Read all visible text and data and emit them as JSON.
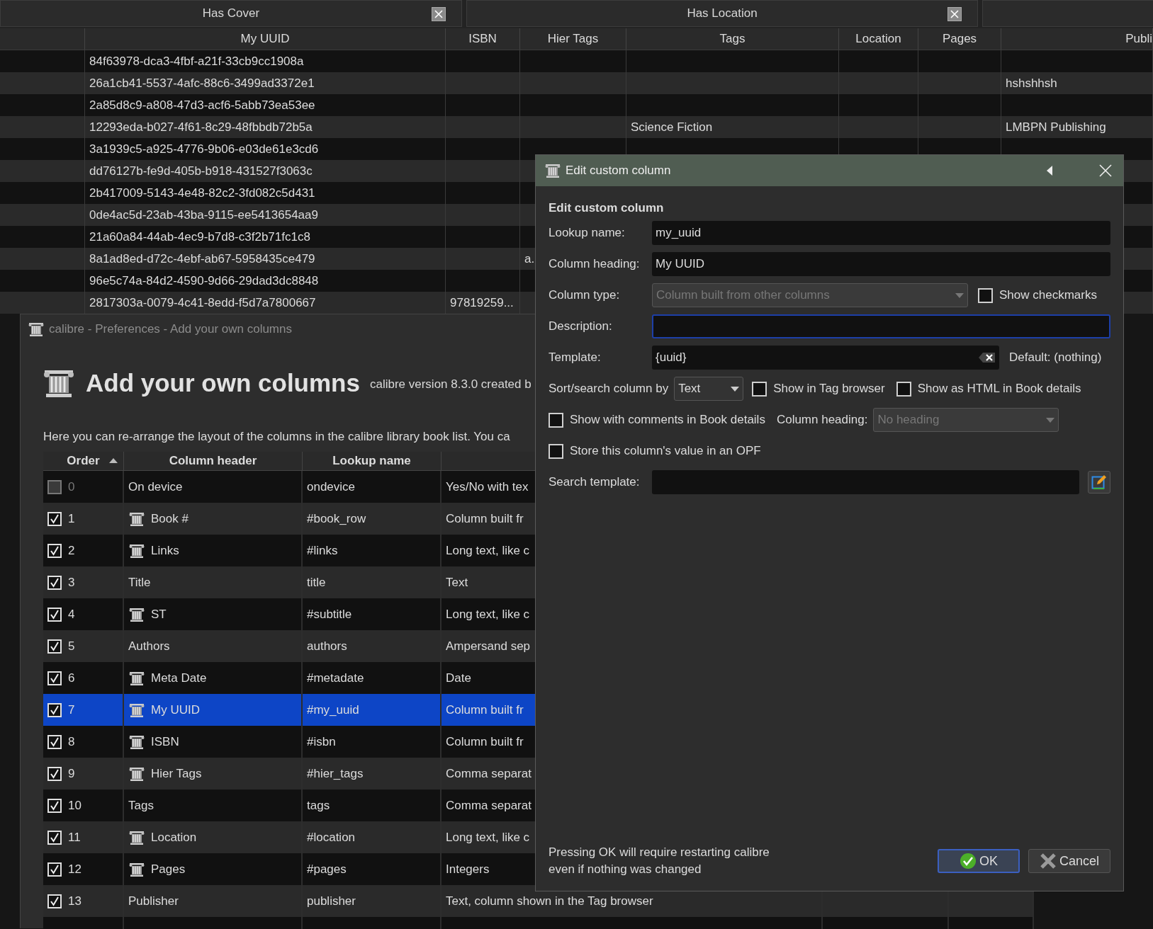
{
  "library": {
    "filter_tabs": [
      {
        "kind": "filter",
        "label": "Has Cover"
      },
      {
        "kind": "filter",
        "label": "Has Location"
      },
      {
        "kind": "empty"
      }
    ],
    "columns": [
      "My UUID",
      "ISBN",
      "Hier Tags",
      "Tags",
      "Location",
      "Pages",
      "Publi"
    ],
    "rows": [
      {
        "my_uuid": "84f63978-dca3-4fbf-a21f-33cb9cc1908a"
      },
      {
        "my_uuid": "26a1cb41-5537-4afc-88c6-3499ad3372e1",
        "publisher": "hshshhsh"
      },
      {
        "my_uuid": "2a85d8c9-a808-47d3-acf6-5abb73ea53ee"
      },
      {
        "my_uuid": "12293eda-b027-4f61-8c29-48fbbdb72b5a",
        "tags": "Science Fiction",
        "publisher": "LMBPN Publishing"
      },
      {
        "my_uuid": "3a1939c5-a925-4776-9b06-e03de61e3cd6"
      },
      {
        "my_uuid": "dd76127b-fe9d-405b-b918-431527f3063c"
      },
      {
        "my_uuid": "2b417009-5143-4e48-82c2-3fd082c5d431"
      },
      {
        "my_uuid": "0de4ac5d-23ab-43ba-9115-ee5413654aa9"
      },
      {
        "my_uuid": "21a60a84-44ab-4ec9-b7d8-c3f2b71fc1c8"
      },
      {
        "my_uuid": "8a1ad8ed-d72c-4ebf-ab67-5958435ce479",
        "hier_tags": "a."
      },
      {
        "my_uuid": "96e5c74a-84d2-4590-9d66-29dad3dc8848"
      },
      {
        "my_uuid": "2817303a-0079-4c41-8edd-f5d7a7800667",
        "isbn": "97819259..."
      }
    ]
  },
  "preferences": {
    "title": "calibre - Preferences - Add your own columns",
    "heading": "Add your own columns",
    "version_note": "calibre version 8.3.0 created b",
    "description": "Here you can re-arrange the layout of the columns in the calibre library book list. You ca",
    "table": {
      "columns": [
        {
          "label": "Order",
          "sorted": true
        },
        {
          "label": "Column header",
          "sorted": false
        },
        {
          "label": "Lookup name",
          "sorted": false
        }
      ],
      "rows": [
        {
          "order": "0",
          "checked": false,
          "disabled": true,
          "custom": false,
          "header": "On device",
          "lookup": "ondevice",
          "type": "Yes/No with tex",
          "selected": false
        },
        {
          "order": "1",
          "checked": true,
          "disabled": false,
          "custom": true,
          "header": "Book #",
          "lookup": "#book_row",
          "type": "Column built fr",
          "selected": false
        },
        {
          "order": "2",
          "checked": true,
          "disabled": false,
          "custom": true,
          "header": "Links",
          "lookup": "#links",
          "type": "Long text, like c",
          "selected": false
        },
        {
          "order": "3",
          "checked": true,
          "disabled": false,
          "custom": false,
          "header": "Title",
          "lookup": "title",
          "type": "Text",
          "selected": false
        },
        {
          "order": "4",
          "checked": true,
          "disabled": false,
          "custom": true,
          "header": "ST",
          "lookup": "#subtitle",
          "type": "Long text, like c",
          "selected": false
        },
        {
          "order": "5",
          "checked": true,
          "disabled": false,
          "custom": false,
          "header": "Authors",
          "lookup": "authors",
          "type": "Ampersand sep",
          "selected": false
        },
        {
          "order": "6",
          "checked": true,
          "disabled": false,
          "custom": true,
          "header": "Meta Date",
          "lookup": "#metadate",
          "type": "Date",
          "selected": false
        },
        {
          "order": "7",
          "checked": true,
          "disabled": false,
          "custom": true,
          "header": "My UUID",
          "lookup": "#my_uuid",
          "type": "Column built fr",
          "selected": true
        },
        {
          "order": "8",
          "checked": true,
          "disabled": false,
          "custom": true,
          "header": "ISBN",
          "lookup": "#isbn",
          "type": "Column built fr",
          "selected": false
        },
        {
          "order": "9",
          "checked": true,
          "disabled": false,
          "custom": true,
          "header": "Hier Tags",
          "lookup": "#hier_tags",
          "type": "Comma separat",
          "selected": false
        },
        {
          "order": "10",
          "checked": true,
          "disabled": false,
          "custom": false,
          "header": "Tags",
          "lookup": "tags",
          "type": "Comma separat",
          "selected": false
        },
        {
          "order": "11",
          "checked": true,
          "disabled": false,
          "custom": true,
          "header": "Location",
          "lookup": "#location",
          "type": "Long text, like c",
          "selected": false
        },
        {
          "order": "12",
          "checked": true,
          "disabled": false,
          "custom": true,
          "header": "Pages",
          "lookup": "#pages",
          "type": "Integers",
          "selected": false
        },
        {
          "order": "13",
          "checked": true,
          "disabled": false,
          "custom": false,
          "header": "Publisher",
          "lookup": "publisher",
          "type": "Text, column shown in the Tag browser",
          "selected": false
        }
      ]
    }
  },
  "dialog": {
    "title": "Edit custom column",
    "heading": "Edit custom column",
    "lookup_name": {
      "label": "Lookup name:",
      "value": "my_uuid"
    },
    "column_heading": {
      "label": "Column heading:",
      "value": "My UUID"
    },
    "column_type": {
      "label": "Column type:",
      "value": "Column built from other columns",
      "disabled": true
    },
    "show_checkmarks": {
      "label": "Show checkmarks",
      "checked": false
    },
    "description": {
      "label": "Description:",
      "focused": true
    },
    "template": {
      "label": "Template:",
      "value": "{uuid}"
    },
    "default_note": "Default: (nothing)",
    "sort_by": {
      "label": "Sort/search column by",
      "value": "Text",
      "disabled": false
    },
    "show_in_tag_browser": {
      "label": "Show in Tag browser",
      "checked": false
    },
    "show_as_html": {
      "label": "Show as HTML in Book details",
      "checked": false
    },
    "show_with_comments": {
      "label": "Show with comments in Book details",
      "checked": false
    },
    "heading_position": {
      "label": "Column heading:",
      "value": "No heading",
      "disabled": true
    },
    "store_in_opf": {
      "label": "Store this column's value in an OPF",
      "checked": false
    },
    "search_template": {
      "label": "Search template:"
    },
    "note": "Pressing OK will require restarting calibre\neven if nothing was changed",
    "buttons": [
      {
        "kind": "ok",
        "label": "OK",
        "default": true
      },
      {
        "kind": "cancel",
        "label": "Cancel",
        "default": false
      }
    ]
  }
}
